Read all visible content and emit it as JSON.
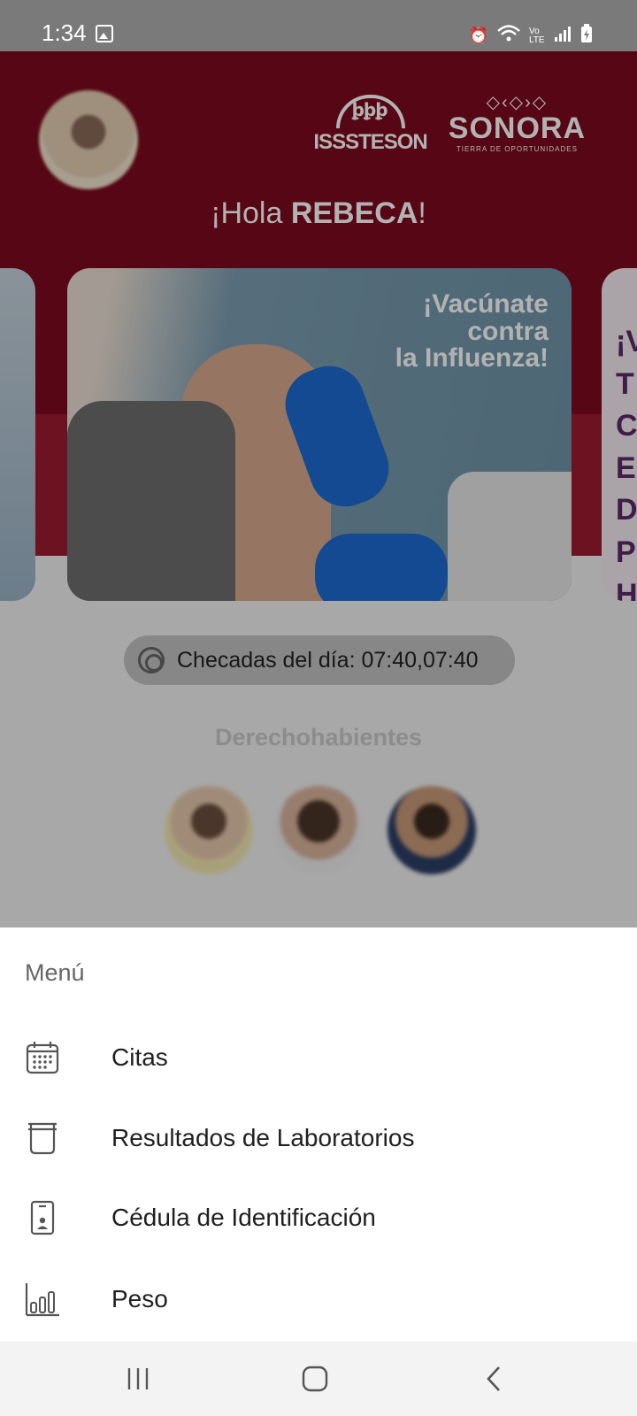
{
  "status_bar": {
    "time": "1:34",
    "icons": [
      "image-icon",
      "alarm-icon",
      "wifi-icon",
      "volte-icon",
      "signal-icon",
      "battery-charging-icon"
    ],
    "volte_text": "Vo LTE"
  },
  "header": {
    "brand_left": "ISSSTESON",
    "brand_right": "SONORA",
    "brand_right_tagline": "TIERRA DE OPORTUNIDADES",
    "greeting_prefix": "¡Hola ",
    "user_name": "REBECA",
    "greeting_suffix": "!"
  },
  "carousel": {
    "main_banner_text": [
      "¡Vacúnate",
      "contra",
      "la Influenza!"
    ],
    "right_peek_text": [
      "¡V",
      "T",
      "C",
      "E",
      "D",
      "P",
      "H"
    ]
  },
  "checadas": {
    "label": "Checadas del día: 07:40,07:40"
  },
  "dependents": {
    "title": "Derechohabientes",
    "count": 3
  },
  "menu": {
    "title": "Menú",
    "items": [
      {
        "label": "Citas",
        "icon": "calendar-icon"
      },
      {
        "label": "Resultados de Laboratorios",
        "icon": "beaker-icon"
      },
      {
        "label": "Cédula de Identificación",
        "icon": "id-card-icon"
      },
      {
        "label": "Peso",
        "icon": "bar-chart-icon"
      }
    ]
  },
  "colors": {
    "brand_red": "#7c0a1d",
    "sheet_bg": "#ffffff",
    "scrim": "rgba(0,0,0,0.30)"
  }
}
